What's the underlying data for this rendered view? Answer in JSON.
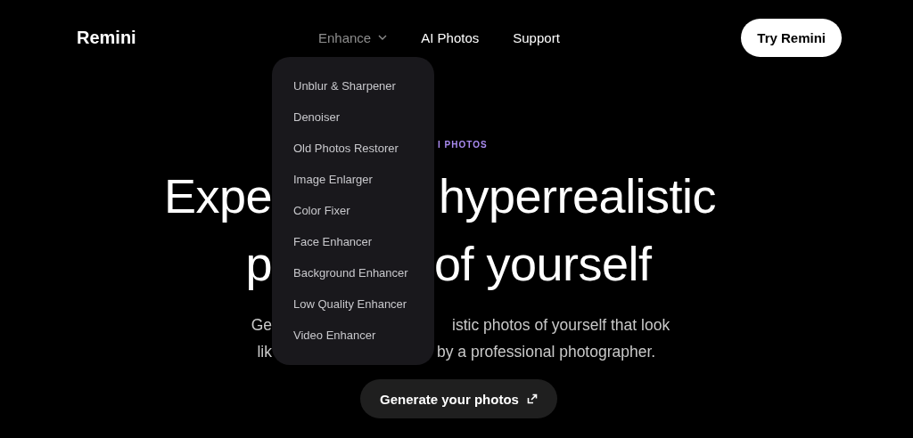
{
  "brand": "Remini",
  "nav": [
    {
      "label": "Enhance",
      "kind": "dropdown",
      "expanded": true
    },
    {
      "label": "AI Photos",
      "kind": "link"
    },
    {
      "label": "Support",
      "kind": "link"
    }
  ],
  "cta": "Try Remini",
  "dropdown_items": [
    "Unblur & Sharpener",
    "Denoiser",
    "Old Photos Restorer",
    "Image Enlarger",
    "Color Fixer",
    "Face Enhancer",
    "Background Enhancer",
    "Low Quality Enhancer",
    "Video Enhancer"
  ],
  "eyebrow": {
    "right": "I PHOTOS"
  },
  "headline": [
    {
      "left": "Expe",
      "right": "hyperrealistic"
    },
    {
      "left": "p",
      "right": "of yourself"
    }
  ],
  "subtitle": [
    {
      "left": "Ge",
      "right": "istic photos of yourself that look"
    },
    {
      "left": "lik",
      "right": "by a professional photographer."
    }
  ],
  "generate_button": "Generate your photos"
}
